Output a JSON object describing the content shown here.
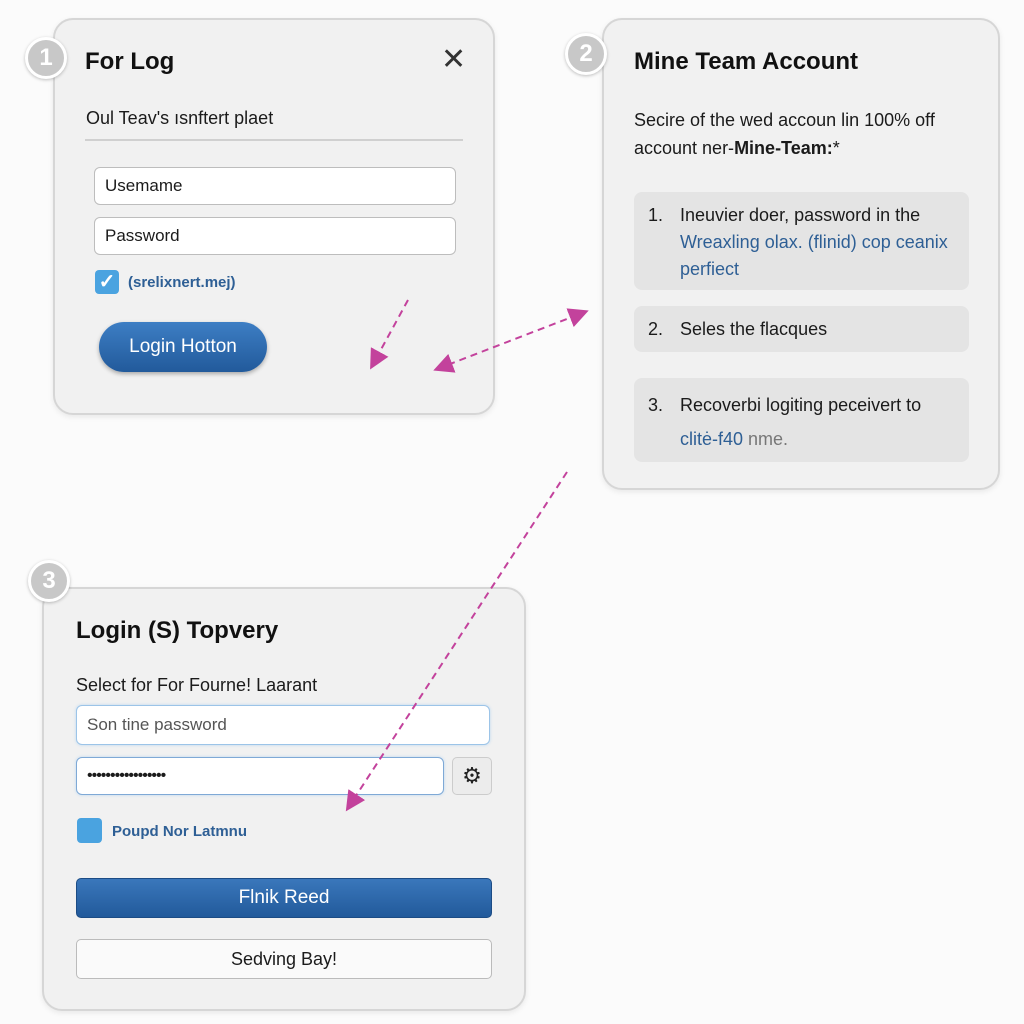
{
  "panel1": {
    "badge": "1",
    "title": "For Log",
    "subtitle": "Oul Teav's ısnftert plaet",
    "username_placeholder": "Usemame",
    "password_placeholder": "Password",
    "checkbox_label": "(srelixnert.mej)",
    "checkbox_checked": true,
    "login_button": "Login Hotton",
    "close_icon": "close-icon"
  },
  "panel2": {
    "badge": "2",
    "title": "Mine Team Account",
    "intro_line1": "Secire of the wed accoun lin 100% off",
    "intro_line2_prefix": "account ner-",
    "intro_line2_bold": "Mine-Team:",
    "intro_line2_suffix": "*",
    "steps": [
      {
        "num": "1.",
        "line1": "Ineuvier doer, password in the",
        "line2": "Wreaxling olax. (flinid) cop ceanix perfiect"
      },
      {
        "num": "2.",
        "line1": "Seles the flacques"
      },
      {
        "num": "3.",
        "line1": "Recoverbi logiting peceivert to",
        "line2_blue": "clitė-f40",
        "line2_grey": " nme."
      }
    ]
  },
  "panel3": {
    "badge": "3",
    "title": "Login (S) Topvery",
    "label": "Select for For Fourne! Laarant",
    "field1_placeholder": "Son tine password",
    "field2_value": "•••••••••••••••••",
    "settings_icon": "gear-icon",
    "checkbox_label": "Poupd Nor Latmnu",
    "checkbox_checked": false,
    "primary_button": "Flnik Reed",
    "secondary_button": "Sedving Bay!"
  },
  "colors": {
    "accent_blue": "#2a64a8",
    "arrow_magenta": "#c3429c",
    "checkbox_blue": "#4aa3e0"
  }
}
